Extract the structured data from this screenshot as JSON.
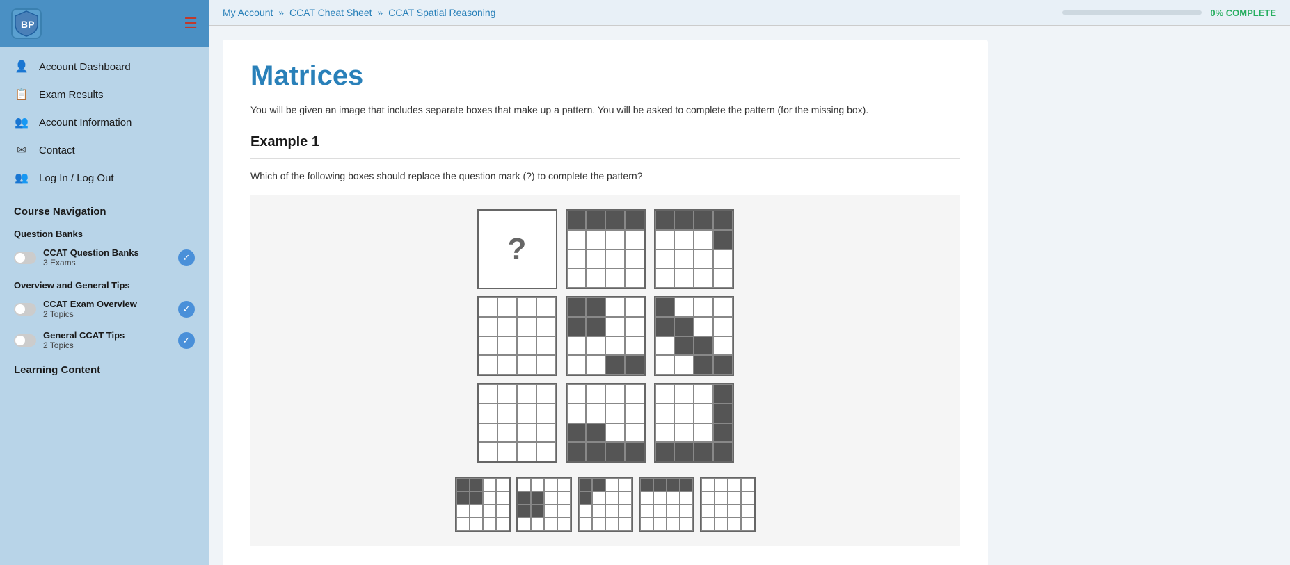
{
  "sidebar": {
    "logo_text": "BP",
    "nav_items": [
      {
        "id": "account-dashboard",
        "label": "Account Dashboard",
        "icon": "👤"
      },
      {
        "id": "exam-results",
        "label": "Exam Results",
        "icon": "📄"
      },
      {
        "id": "account-information",
        "label": "Account Information",
        "icon": "👥"
      },
      {
        "id": "contact",
        "label": "Contact",
        "icon": "✉"
      },
      {
        "id": "login-logout",
        "label": "Log In / Log Out",
        "icon": "👥"
      }
    ],
    "course_navigation_label": "Course Navigation",
    "question_banks_label": "Question Banks",
    "ccat_question_banks": {
      "title": "CCAT Question Banks",
      "sub": "3 Exams"
    },
    "overview_label": "Overview and General Tips",
    "ccat_exam_overview": {
      "title": "CCAT Exam Overview",
      "sub": "2 Topics"
    },
    "general_ccat_tips": {
      "title": "General CCAT Tips",
      "sub": "2 Topics"
    },
    "learning_content_label": "Learning Content"
  },
  "breadcrumb": {
    "my_account": "My Account",
    "ccat_cheat_sheet": "CCAT Cheat Sheet",
    "ccat_spatial_reasoning": "CCAT Spatial Reasoning",
    "separator": "»"
  },
  "progress": {
    "label": "0% COMPLETE",
    "value": 0
  },
  "content": {
    "title": "Matrices",
    "description": "You will be given an image that includes separate boxes that make up a pattern. You will be asked to complete the pattern (for the missing box).",
    "example1_heading": "Example 1",
    "example1_question": "Which of the following boxes should replace the question mark (?) to complete the pattern?"
  }
}
